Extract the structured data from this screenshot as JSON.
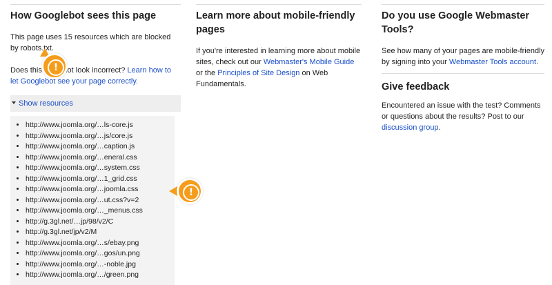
{
  "col1": {
    "title": "How Googlebot sees this page",
    "intro": "This page uses 15 resources which are blocked by robots.txt.",
    "incorrect_prefix": "Does this page not look incorrect?",
    "incorrect_link": "Learn how to let Googlebot see your page correctly.",
    "toggle_label": "Show resources",
    "resources": [
      "http://www.joomla.org/…ls-core.js",
      "http://www.joomla.org/…js/core.js",
      "http://www.joomla.org/…caption.js",
      "http://www.joomla.org/…eneral.css",
      "http://www.joomla.org/…system.css",
      "http://www.joomla.org/…1_grid.css",
      "http://www.joomla.org/…joomla.css",
      "http://www.joomla.org/…ut.css?v=2",
      "http://www.joomla.org/…_menus.css",
      "http://g.3gl.net/…jp/98/v2/C",
      "http://g.3gl.net/jp/v2/M",
      "http://www.joomla.org/…s/ebay.png",
      "http://www.joomla.org/…gos/un.png",
      "http://www.joomla.org/…-noble.jpg",
      "http://www.joomla.org/…/green.png"
    ]
  },
  "col2": {
    "title": "Learn more about mobile-friendly pages",
    "text_a": "If you're interested in learning more about mobile sites, check out our",
    "link_a": "Webmaster's Mobile Guide",
    "text_b": "or the",
    "link_b": "Principles of Site Design",
    "text_c": "on Web Fundamentals."
  },
  "col3": {
    "title": "Do you use Google Webmaster Tools?",
    "text_a": "See how many of your pages are mobile-friendly by signing into your",
    "link_a": "Webmaster Tools account",
    "text_b": ".",
    "feedback_title": "Give feedback",
    "feedback_text": "Encountered an issue with the test? Comments or questions about the results? Post to our",
    "feedback_link": "discussion group",
    "feedback_end": "."
  },
  "icons": {
    "marker_glyph": "!"
  },
  "colors": {
    "marker": "#f59c1a",
    "link": "#1a4fc9"
  }
}
